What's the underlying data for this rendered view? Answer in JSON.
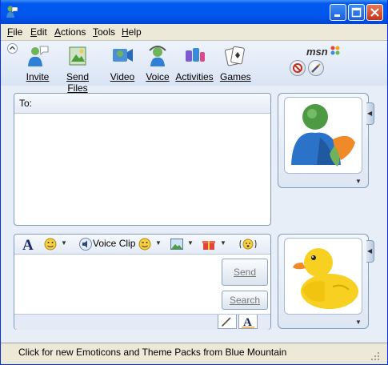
{
  "window": {
    "title": ""
  },
  "menu": {
    "items": [
      {
        "label": "File"
      },
      {
        "label": "Edit"
      },
      {
        "label": "Actions"
      },
      {
        "label": "Tools"
      },
      {
        "label": "Help"
      }
    ]
  },
  "toolbar": {
    "invite": "Invite",
    "send_files": "Send Files",
    "video": "Video",
    "voice": "Voice",
    "activities": "Activities",
    "games": "Games",
    "logo": "msn"
  },
  "conversation": {
    "to_label": "To:",
    "to_value": ""
  },
  "compose": {
    "voice_clip": "Voice Clip",
    "send_label": "Send",
    "search_label": "Search",
    "message": ""
  },
  "status": {
    "text": "Click for new Emoticons and Theme Packs from Blue Mountain"
  },
  "colors": {
    "title_bar": "#0058ee",
    "accent": "#7f9db9",
    "menu_bg": "#ece9d8"
  }
}
